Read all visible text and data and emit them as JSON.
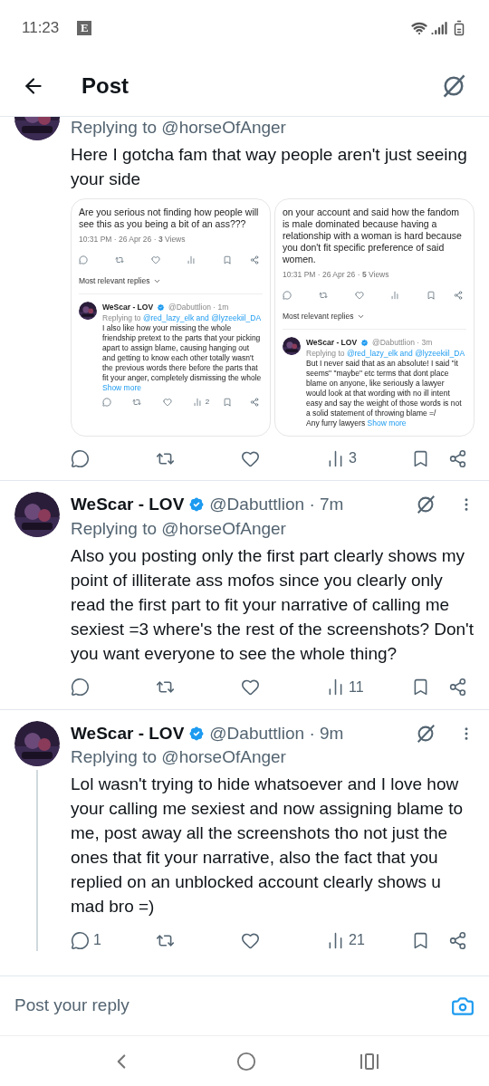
{
  "status_bar": {
    "time": "11:23",
    "notification_icon": "E"
  },
  "header": {
    "title": "Post"
  },
  "tweets": [
    {
      "replying_prefix": "Replying to",
      "replying_to": "@horseOfAnger",
      "text": "Here I gotcha fam that way people aren't just seeing your side",
      "connected_below": false,
      "images": [
        {
          "text": "Are you serious not finding how people will see this as you being a bit of an ass???",
          "meta": "10:31 PM · 26 Apr 26 · **3** Views",
          "sort_label": "Most relevant replies",
          "reply": {
            "name": "WeScar - LOV",
            "verified": true,
            "handle": "@Dabuttlion · 1m",
            "replying_prefix": "Replying to",
            "replying_to": "@red_lazy_elk and @lyzeekiil_DA",
            "text": "I also like how your missing the whole friendship pretext to the parts that your picking apart to assign blame, causing hanging out and getting to know each other totally wasn't the previous words there before the parts that fit your anger, completely dismissing the whole",
            "show_more": "Show more",
            "views": "2"
          }
        },
        {
          "text": "on your account and said how the fandom is male dominated because having a relationship with a woman is hard because you don't fit specific preference of said women.",
          "meta": "10:31 PM · 26 Apr 26 · **5** Views",
          "sort_label": "Most relevant replies",
          "reply": {
            "name": "WeScar - LOV",
            "verified": true,
            "handle": "@Dabuttlion · 3m",
            "replying_prefix": "Replying to",
            "replying_to": "@red_lazy_elk and @lyzeekiil_DA",
            "text": "But I never said that as an absolute! I said \"it seems\" \"maybe\" etc terms that dont place blame on anyone, like seriously a lawyer would look at that wording with no ill intent easy and say the weight of those words is not a solid statement of throwing blame =/\nAny furry lawyers",
            "show_more": "Show more"
          }
        }
      ],
      "actions": {
        "views": "3"
      }
    },
    {
      "author": {
        "name": "WeScar - LOV",
        "verified": true,
        "handle": "@Dabuttlion · 7m"
      },
      "replying_prefix": "Replying to",
      "replying_to": "@horseOfAnger",
      "text": "Also you posting only the first part clearly shows my point of illiterate ass mofos since you clearly only read the first part to fit your narrative of calling me sexiest =3 where's the rest of the screenshots? Don't you want everyone to see the whole thing?",
      "connected_below": false,
      "actions": {
        "views": "11"
      }
    },
    {
      "author": {
        "name": "WeScar - LOV",
        "verified": true,
        "handle": "@Dabuttlion · 9m"
      },
      "replying_prefix": "Replying to",
      "replying_to": "@horseOfAnger",
      "text": "Lol wasn't trying to hide whatsoever and I love how your calling me sexiest and now assigning blame to me, post away all the screenshots tho not just the ones that fit your narrative, also the fact that you replied on an unblocked account clearly shows u mad bro =)",
      "connected_below": true,
      "actions": {
        "replies": "1",
        "views": "21"
      }
    }
  ],
  "composer": {
    "placeholder": "Post your reply"
  }
}
